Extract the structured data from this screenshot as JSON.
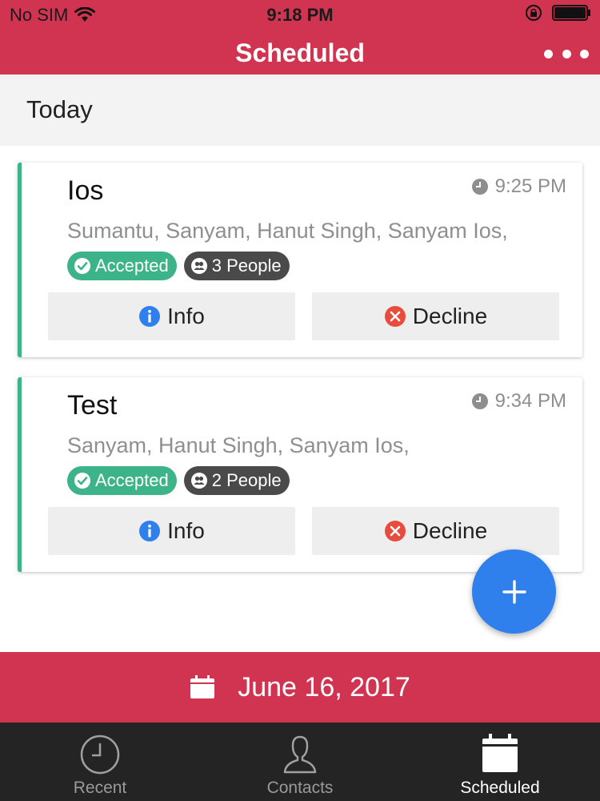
{
  "status_bar": {
    "carrier": "No SIM",
    "time": "9:18 PM"
  },
  "nav": {
    "title": "Scheduled",
    "more_icon": "more-horizontal-icon"
  },
  "section": {
    "label": "Today"
  },
  "events": [
    {
      "title": "Ios",
      "time": "9:25 PM",
      "participants": "Sumantu, Sanyam, Hanut Singh, Sanyam Ios,",
      "status": "Accepted",
      "people": "3 People",
      "info_label": "Info",
      "decline_label": "Decline"
    },
    {
      "title": "Test",
      "time": "9:34 PM",
      "participants": "Sanyam, Hanut Singh, Sanyam Ios,",
      "status": "Accepted",
      "people": "2 People",
      "info_label": "Info",
      "decline_label": "Decline"
    }
  ],
  "date_bar": {
    "date": "June 16, 2017"
  },
  "tabs": [
    {
      "label": "Recent",
      "icon": "clock-icon",
      "active": false
    },
    {
      "label": "Contacts",
      "icon": "person-icon",
      "active": false
    },
    {
      "label": "Scheduled",
      "icon": "calendar-icon",
      "active": true
    }
  ],
  "colors": {
    "primary": "#d03451",
    "accepted": "#3db38a",
    "fab": "#2f80ed",
    "info": "#2f80ed",
    "decline": "#e84c3d",
    "tab_bar": "#242424"
  }
}
